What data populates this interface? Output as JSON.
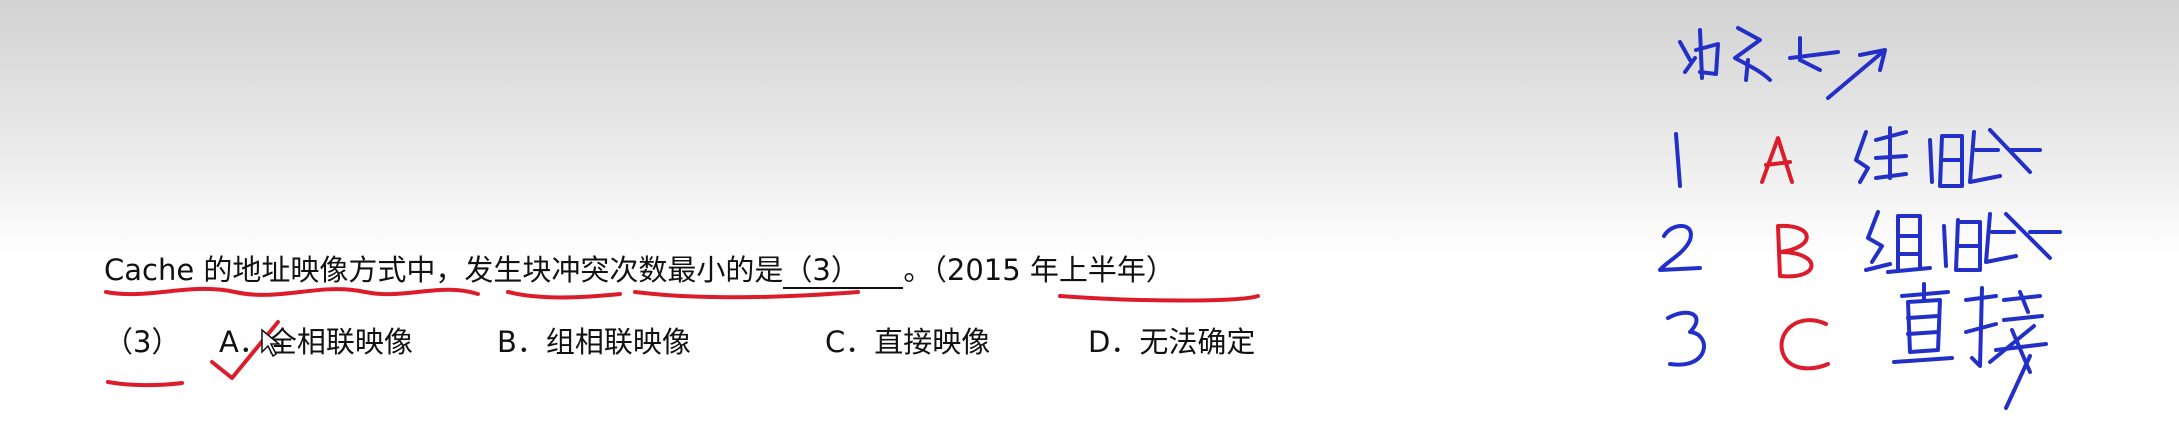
{
  "question": {
    "text_pre": "Cache 的地址映像方式中，发生块冲突次数最小的是",
    "blank": " （3）",
    "text_post": "。（2015 年上半年）"
  },
  "options": {
    "number": "（3）",
    "a": "A．全相联映像",
    "b": "B．组相联映像",
    "c": "C．直接映像",
    "d": "D．无法确定"
  },
  "handwriting": {
    "title": "冲突↓",
    "rows": [
      {
        "num": "1",
        "letter": "A",
        "label": "全相联"
      },
      {
        "num": "2",
        "letter": "B",
        "label": "组相联"
      },
      {
        "num": "3",
        "letter": "C",
        "label": "直接"
      }
    ]
  },
  "colors": {
    "red_ink": "#dd1c2b",
    "blue_ink": "#2230c8"
  }
}
